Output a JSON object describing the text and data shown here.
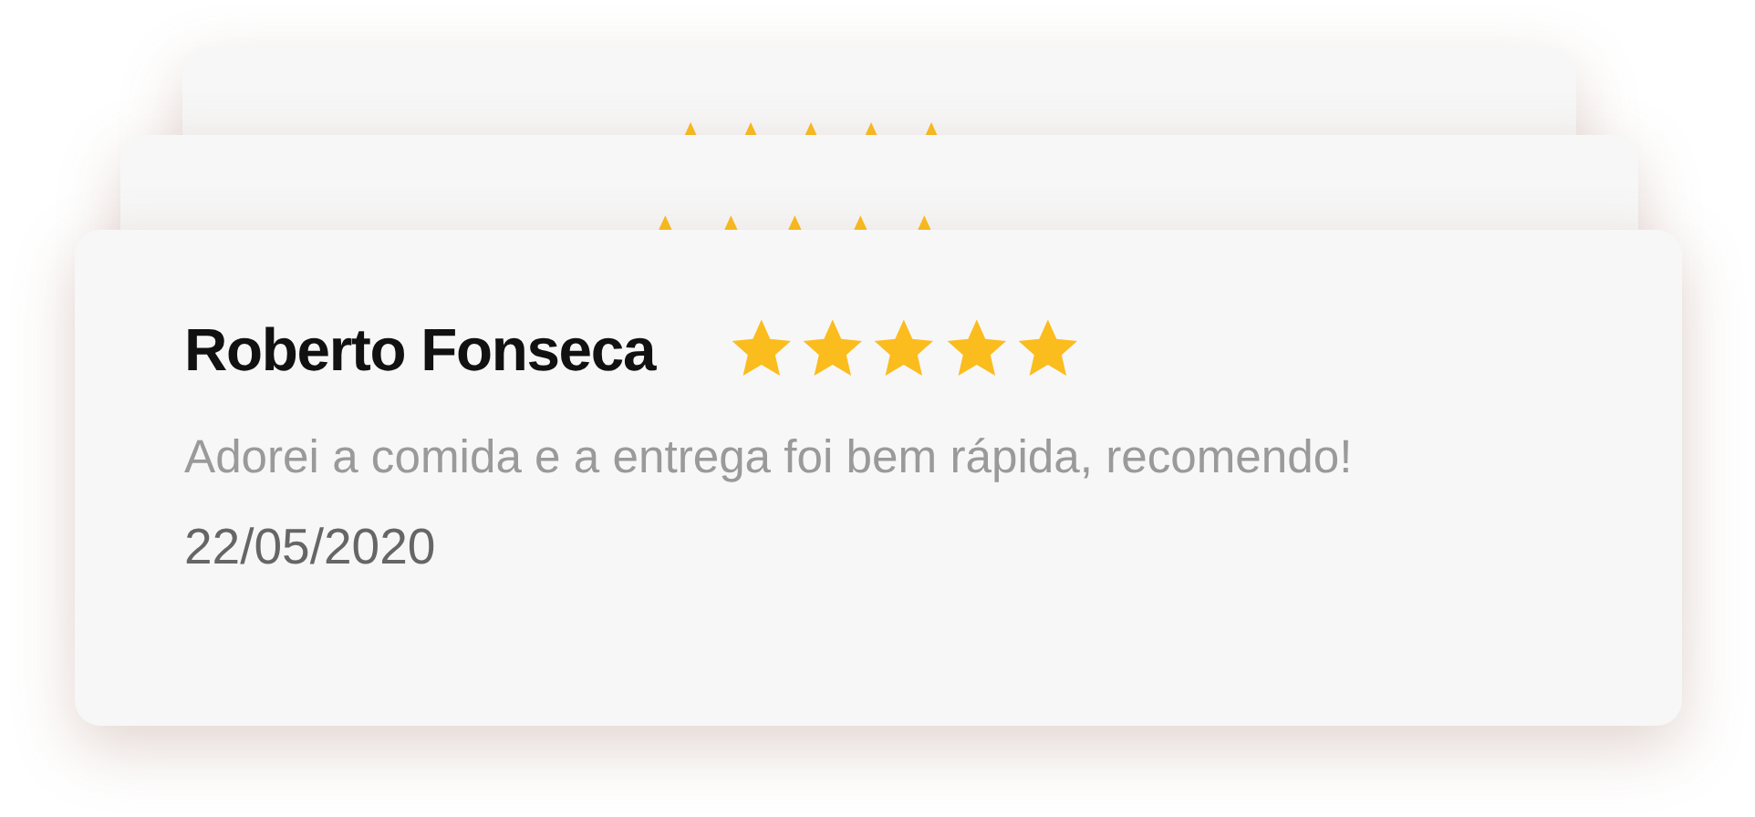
{
  "reviews": [
    {
      "stars": 5
    },
    {
      "stars": 5
    },
    {
      "name": "Roberto Fonseca",
      "stars": 5,
      "text": "Adorei a comida e a entrega foi bem rápida, recomendo!",
      "date": "22/05/2020"
    }
  ]
}
